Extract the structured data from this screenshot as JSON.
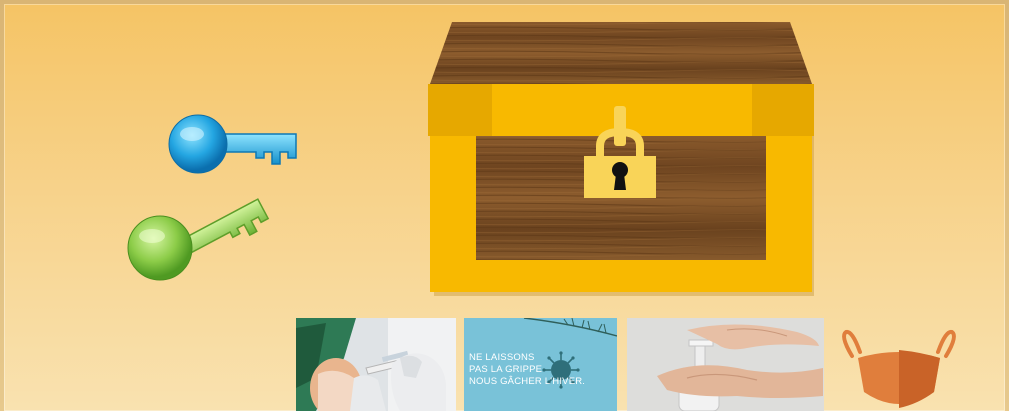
{
  "scene": {
    "background_color": "#f6cc78",
    "items": [
      {
        "name": "blue-key",
        "icon": "key-icon",
        "color": "#2aa8e0"
      },
      {
        "name": "green-key",
        "icon": "key-icon",
        "color": "#8fcf4e"
      },
      {
        "name": "treasure-chest",
        "icon": "chest-icon",
        "state": "locked",
        "color": "#f8b900"
      }
    ]
  },
  "cards": {
    "vaccine": {
      "icon": "vaccination-photo"
    },
    "poster": {
      "line1": "NE LAISSONS",
      "line2": "PAS LA GRIPPE",
      "line3": "NOUS GÂCHER L'HIVER.",
      "color": "#79c2d8"
    },
    "hands": {
      "icon": "hand-sanitizer-photo"
    },
    "mask": {
      "icon": "face-mask-icon",
      "color": "#e07e3c"
    }
  }
}
